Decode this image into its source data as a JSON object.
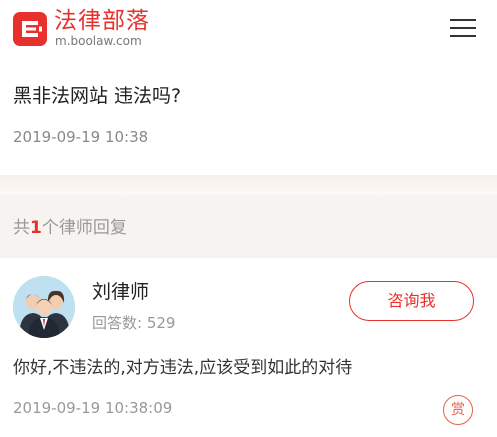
{
  "header": {
    "site_name": "法律部落",
    "domain": "m.boolaw.com",
    "menu_icon": "menu-icon",
    "brand_color": "#e8302c"
  },
  "question": {
    "title": "黑非法网站 违法吗?",
    "date": "2019-09-19 10:38"
  },
  "replies": {
    "prefix": "共",
    "count": "1",
    "suffix": "个律师回复"
  },
  "answer": {
    "lawyer_name": "刘律师",
    "answer_count_label": "回答数:",
    "answer_count": "529",
    "consult_label": "咨询我",
    "text": "你好,不违法的,对方违法,应该受到如此的对待",
    "date": "2019-09-19 10:38:09",
    "reward_label": "赏"
  }
}
